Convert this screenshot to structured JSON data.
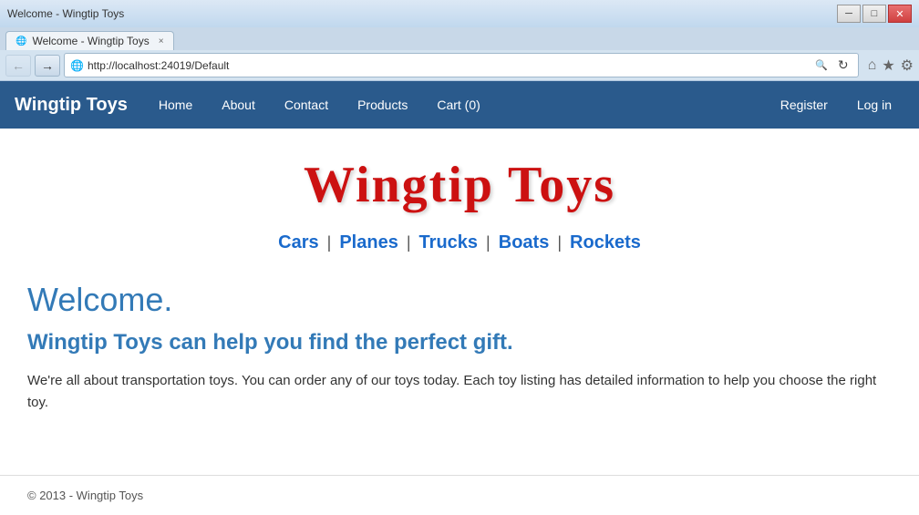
{
  "window": {
    "title": "Welcome - Wingtip Toys",
    "url": "http://localhost:24019/Default",
    "controls": {
      "minimize": "─",
      "maximize": "□",
      "close": "✕"
    }
  },
  "tab": {
    "favicon": "⭐",
    "label": "Welcome - Wingtip Toys",
    "close": "×"
  },
  "address": {
    "url": "http://localhost:24019/Default",
    "search_placeholder": "Search"
  },
  "toolbar": {
    "home": "⌂",
    "favorites": "★",
    "settings": "⚙"
  },
  "navbar": {
    "brand": "Wingtip Toys",
    "links": [
      {
        "label": "Home",
        "href": "#"
      },
      {
        "label": "About",
        "href": "#"
      },
      {
        "label": "Contact",
        "href": "#"
      },
      {
        "label": "Products",
        "href": "#"
      },
      {
        "label": "Cart (0)",
        "href": "#"
      }
    ],
    "right_links": [
      {
        "label": "Register",
        "href": "#"
      },
      {
        "label": "Log in",
        "href": "#"
      }
    ]
  },
  "page": {
    "site_title": "Wingtip Toys",
    "categories": [
      {
        "label": "Cars",
        "href": "#"
      },
      {
        "label": "Planes",
        "href": "#"
      },
      {
        "label": "Trucks",
        "href": "#"
      },
      {
        "label": "Boats",
        "href": "#"
      },
      {
        "label": "Rockets",
        "href": "#"
      }
    ],
    "welcome_heading": "Welcome.",
    "welcome_subheading": "Wingtip Toys can help you find the perfect gift.",
    "welcome_text": "We're all about transportation toys. You can order any of our toys today. Each toy listing has detailed information to help you choose the right toy.",
    "footer": "© 2013 - Wingtip Toys"
  }
}
